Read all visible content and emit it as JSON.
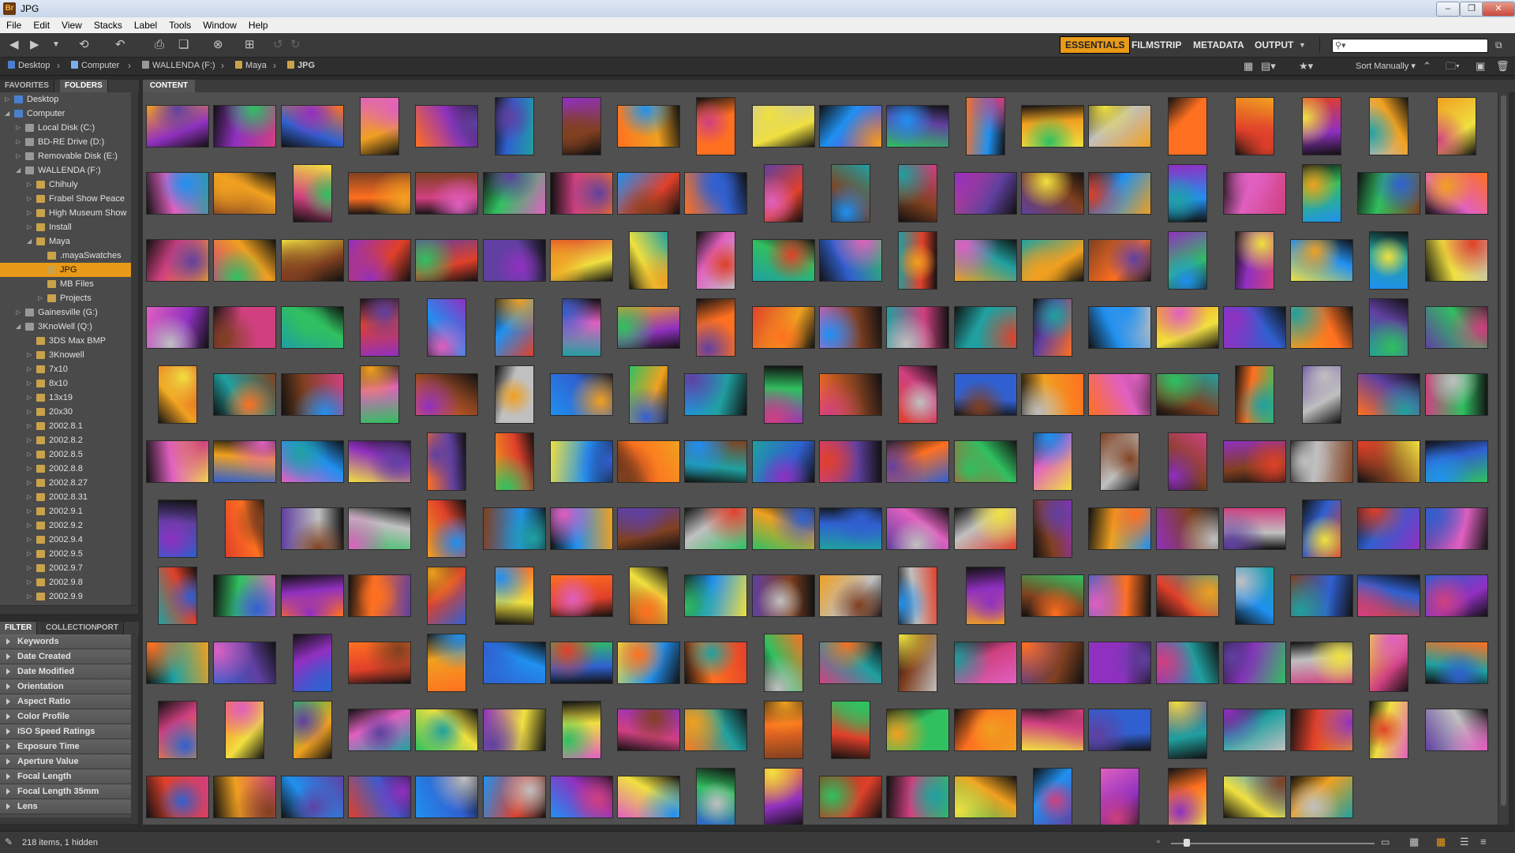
{
  "window": {
    "title": "JPG",
    "app_icon": "Br",
    "buttons": [
      "minimize",
      "restore",
      "close"
    ]
  },
  "menu": [
    "File",
    "Edit",
    "View",
    "Stacks",
    "Label",
    "Tools",
    "Window",
    "Help"
  ],
  "toolbar": {
    "workspaces": [
      "ESSENTIALS",
      "FILMSTRIP",
      "METADATA",
      "OUTPUT"
    ],
    "active_workspace": "ESSENTIALS",
    "search_placeholder": ""
  },
  "path": [
    "Desktop",
    "Computer",
    "WALLENDA (F:)",
    "Maya",
    "JPG"
  ],
  "sort": {
    "label": "Sort Manually"
  },
  "left_tabs_top": [
    "FAVORITES",
    "FOLDERS"
  ],
  "folders": [
    {
      "label": "Desktop",
      "depth": 0,
      "arrow": "▷"
    },
    {
      "label": "Computer",
      "depth": 0,
      "arrow": "◢"
    },
    {
      "label": "Local Disk (C:)",
      "depth": 1,
      "arrow": "▷"
    },
    {
      "label": "BD-RE Drive (D:)",
      "depth": 1,
      "arrow": "▷"
    },
    {
      "label": "Removable Disk (E:)",
      "depth": 1,
      "arrow": "▷"
    },
    {
      "label": "WALLENDA (F:)",
      "depth": 1,
      "arrow": "◢"
    },
    {
      "label": "Chihuly",
      "depth": 2,
      "arrow": "▷"
    },
    {
      "label": "Frabel Show Peace",
      "depth": 2,
      "arrow": "▷"
    },
    {
      "label": "High Museum Show",
      "depth": 2,
      "arrow": "▷"
    },
    {
      "label": "Install",
      "depth": 2,
      "arrow": "▷"
    },
    {
      "label": "Maya",
      "depth": 2,
      "arrow": "◢"
    },
    {
      "label": ".mayaSwatches",
      "depth": 3,
      "arrow": ""
    },
    {
      "label": "JPG",
      "depth": 3,
      "arrow": "",
      "selected": true
    },
    {
      "label": "MB Files",
      "depth": 3,
      "arrow": ""
    },
    {
      "label": "Projects",
      "depth": 3,
      "arrow": "▷"
    },
    {
      "label": "Gainesville (G:)",
      "depth": 1,
      "arrow": "▷"
    },
    {
      "label": "3KnoWell (Q:)",
      "depth": 1,
      "arrow": "◢"
    },
    {
      "label": "3DS Max BMP",
      "depth": 2,
      "arrow": ""
    },
    {
      "label": "3Knowell",
      "depth": 2,
      "arrow": "▷"
    },
    {
      "label": "7x10",
      "depth": 2,
      "arrow": "▷"
    },
    {
      "label": "8x10",
      "depth": 2,
      "arrow": "▷"
    },
    {
      "label": "13x19",
      "depth": 2,
      "arrow": "▷"
    },
    {
      "label": "20x30",
      "depth": 2,
      "arrow": "▷"
    },
    {
      "label": "2002.8.1",
      "depth": 2,
      "arrow": "▷"
    },
    {
      "label": "2002.8.2",
      "depth": 2,
      "arrow": "▷"
    },
    {
      "label": "2002.8.5",
      "depth": 2,
      "arrow": "▷"
    },
    {
      "label": "2002.8.8",
      "depth": 2,
      "arrow": "▷"
    },
    {
      "label": "2002.8.27",
      "depth": 2,
      "arrow": "▷"
    },
    {
      "label": "2002.8.31",
      "depth": 2,
      "arrow": "▷"
    },
    {
      "label": "2002.9.1",
      "depth": 2,
      "arrow": "▷"
    },
    {
      "label": "2002.9.2",
      "depth": 2,
      "arrow": "▷"
    },
    {
      "label": "2002.9.4",
      "depth": 2,
      "arrow": "▷"
    },
    {
      "label": "2002.9.5",
      "depth": 2,
      "arrow": "▷"
    },
    {
      "label": "2002.9.7",
      "depth": 2,
      "arrow": "▷"
    },
    {
      "label": "2002.9.8",
      "depth": 2,
      "arrow": "▷"
    },
    {
      "label": "2002.9.9",
      "depth": 2,
      "arrow": "▷"
    }
  ],
  "left_tabs_bottom": [
    "FILTER",
    "COLLECTIONS",
    "EXPORT"
  ],
  "filters": [
    "Keywords",
    "Date Created",
    "Date Modified",
    "Orientation",
    "Aspect Ratio",
    "Color Profile",
    "ISO Speed Ratings",
    "Exposure Time",
    "Aperture Value",
    "Focal Length",
    "Focal Length 35mm",
    "Lens"
  ],
  "content_tab": "CONTENT",
  "status": "218 items, 1 hidden",
  "thumbnail_count": 218,
  "colors": {
    "accent": "#e89a18",
    "panel": "#4a4a4a",
    "content_bg": "#505050"
  }
}
